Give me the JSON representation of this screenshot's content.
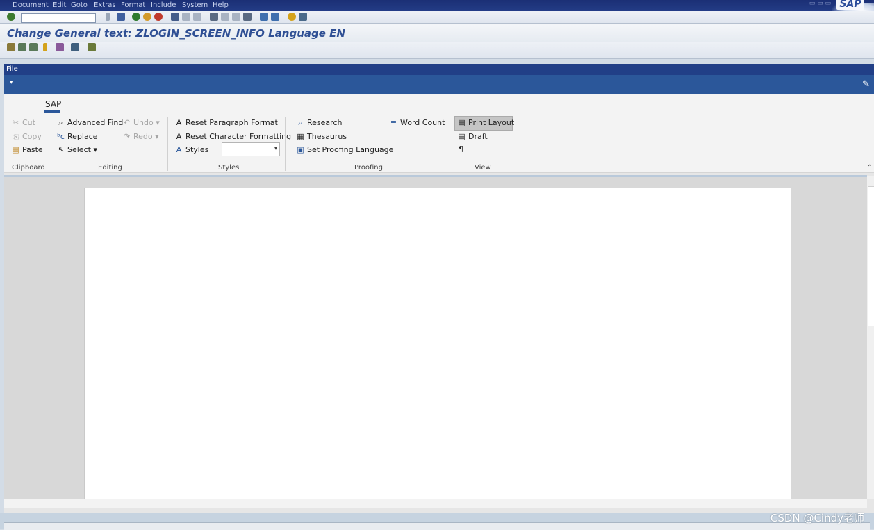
{
  "menu": [
    "Document",
    "Edit",
    "Goto",
    "Extras",
    "Format",
    "Include",
    "System",
    "Help"
  ],
  "sap_logo": "SAP",
  "title": "Change General text: ZLOGIN_SCREEN_INFO Language EN",
  "word": {
    "file_tab": "File",
    "qat_glyph": "❒",
    "tab": "SAP",
    "clipboard": {
      "cut": "Cut",
      "copy": "Copy",
      "paste": "Paste",
      "group": "Clipboard"
    },
    "editing": {
      "advanced_find": "Advanced Find",
      "replace": "Replace",
      "select": "Select",
      "undo": "Undo",
      "redo": "Redo",
      "group": "Editing"
    },
    "styles": {
      "reset_paragraph": "Reset Paragraph Format",
      "reset_character": "Reset Character Formatting",
      "styles": "Styles",
      "style_value": "",
      "group": "Styles"
    },
    "proofing": {
      "research": "Research",
      "thesaurus": "Thesaurus",
      "set_proofing": "Set Proofing Language",
      "word_count": "Word Count",
      "group": "Proofing"
    },
    "view": {
      "print_layout": "Print Layout",
      "draft": "Draft",
      "pilcrow": "¶",
      "group": "View"
    }
  },
  "watermark": "CSDN @Cindy老师",
  "colors": {
    "menubar": "#1b2f75",
    "ribbon_accent": "#2b579a",
    "title": "#2f4f94"
  }
}
